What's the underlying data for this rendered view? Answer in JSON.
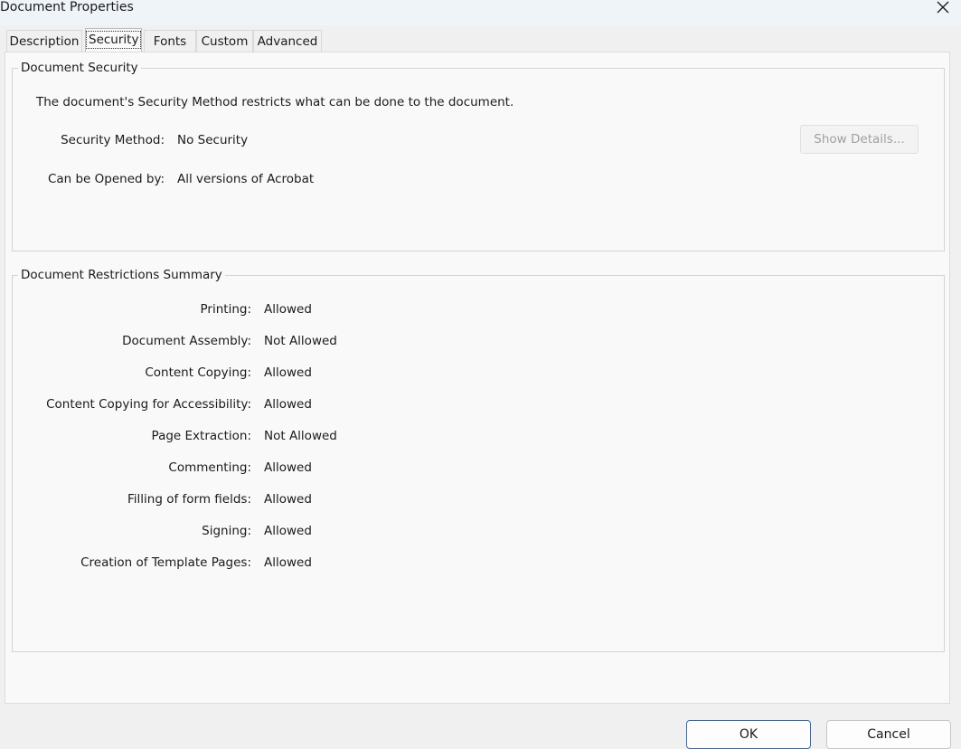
{
  "window": {
    "title": "Document Properties"
  },
  "tabs": [
    {
      "label": "Description"
    },
    {
      "label": "Security"
    },
    {
      "label": "Fonts"
    },
    {
      "label": "Custom"
    },
    {
      "label": "Advanced"
    }
  ],
  "security_group": {
    "legend": "Document Security",
    "intro": "The document's Security Method restricts what can be done to the document.",
    "method_label": "Security Method:",
    "method_value": "No Security",
    "opened_label": "Can be Opened by:",
    "opened_value": "All versions of Acrobat",
    "show_details_label": "Show Details..."
  },
  "restrictions_group": {
    "legend": "Document Restrictions Summary",
    "rows": [
      {
        "label": "Printing:",
        "value": "Allowed"
      },
      {
        "label": "Document Assembly:",
        "value": "Not Allowed"
      },
      {
        "label": "Content Copying:",
        "value": "Allowed"
      },
      {
        "label": "Content Copying for Accessibility:",
        "value": "Allowed"
      },
      {
        "label": "Page Extraction:",
        "value": "Not Allowed"
      },
      {
        "label": "Commenting:",
        "value": "Allowed"
      },
      {
        "label": "Filling of form fields:",
        "value": "Allowed"
      },
      {
        "label": "Signing:",
        "value": "Allowed"
      },
      {
        "label": "Creation of Template Pages:",
        "value": "Allowed"
      }
    ]
  },
  "footer": {
    "ok_label": "OK",
    "cancel_label": "Cancel"
  },
  "icons": {
    "close": "close-icon"
  },
  "colors": {
    "accent": "#2e6bb6"
  }
}
